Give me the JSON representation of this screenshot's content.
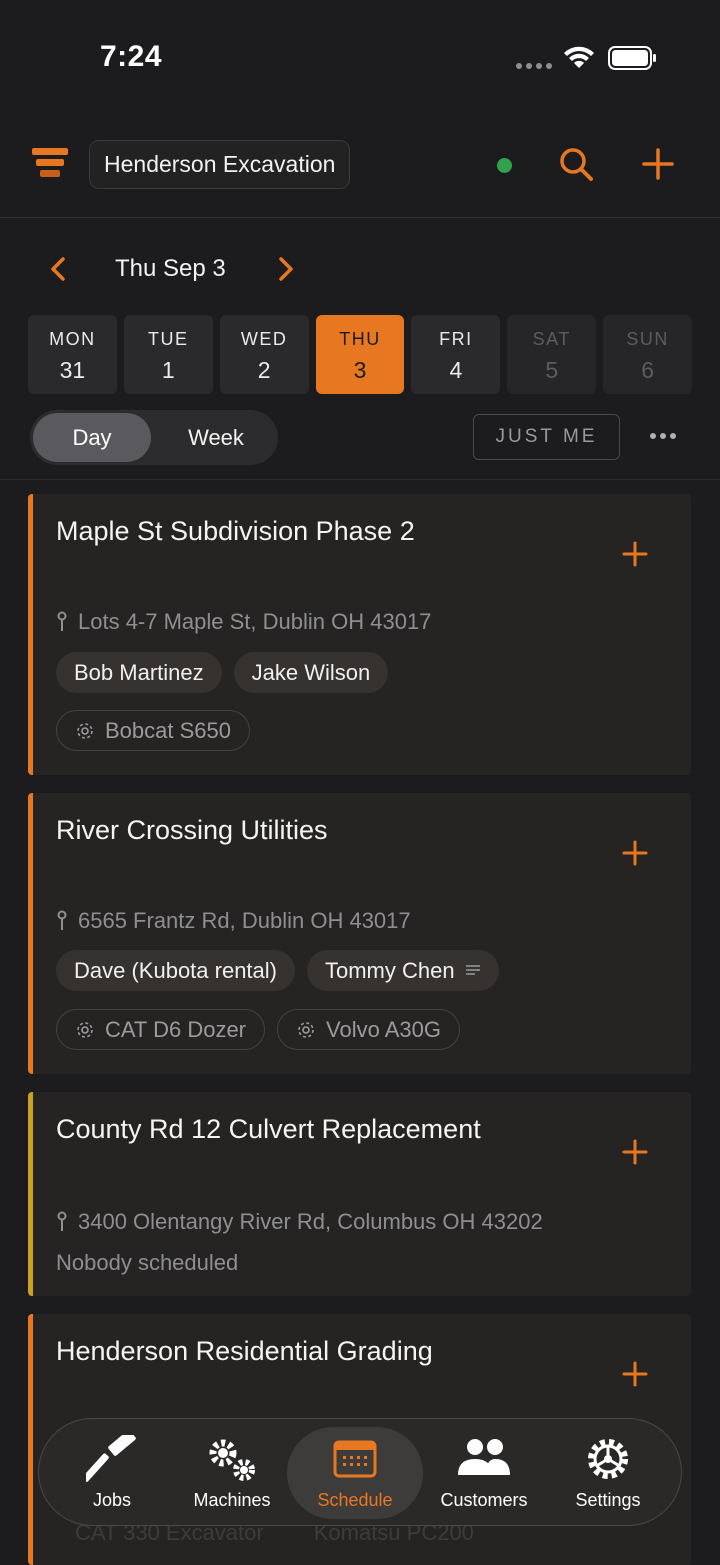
{
  "status_bar": {
    "time": "7:24"
  },
  "header": {
    "company": "Henderson Excavation"
  },
  "date_nav": {
    "label": "Thu Sep 3",
    "days": [
      {
        "name": "MON",
        "num": "31"
      },
      {
        "name": "TUE",
        "num": "1"
      },
      {
        "name": "WED",
        "num": "2"
      },
      {
        "name": "THU",
        "num": "3"
      },
      {
        "name": "FRI",
        "num": "4"
      },
      {
        "name": "SAT",
        "num": "5"
      },
      {
        "name": "SUN",
        "num": "6"
      }
    ]
  },
  "view_toggle": {
    "day": "Day",
    "week": "Week"
  },
  "filter": {
    "just_me": "JUST ME"
  },
  "jobs": [
    {
      "title": "Maple St Subdivision Phase 2",
      "address": "Lots 4-7 Maple St, Dublin OH 43017",
      "crew": [
        "Bob Martinez",
        "Jake Wilson"
      ],
      "machines": [
        "Bobcat S650"
      ]
    },
    {
      "title": "River Crossing Utilities",
      "address": "6565 Frantz Rd, Dublin OH 43017",
      "crew": [
        "Dave (Kubota rental)",
        "Tommy Chen"
      ],
      "machines": [
        "CAT D6 Dozer",
        "Volvo A30G"
      ]
    },
    {
      "title": "County Rd 12 Culvert Replacement",
      "address": "3400 Olentangy River Rd, Columbus OH 43202",
      "status": "Nobody scheduled"
    },
    {
      "title": "Henderson Residential Grading",
      "machines": [
        "CAT 330 Excavator",
        "Komatsu PC200"
      ]
    }
  ],
  "tabs": [
    {
      "label": "Jobs",
      "icon": "hammer-icon"
    },
    {
      "label": "Machines",
      "icon": "gears-icon"
    },
    {
      "label": "Schedule",
      "icon": "calendar-icon"
    },
    {
      "label": "Customers",
      "icon": "people-icon"
    },
    {
      "label": "Settings",
      "icon": "gear-icon"
    }
  ],
  "colors": {
    "accent": "#e87722",
    "background": "#1c1c1e",
    "card": "#262422",
    "online": "#31a24c",
    "card_stripe_alt": "#c9a227"
  }
}
